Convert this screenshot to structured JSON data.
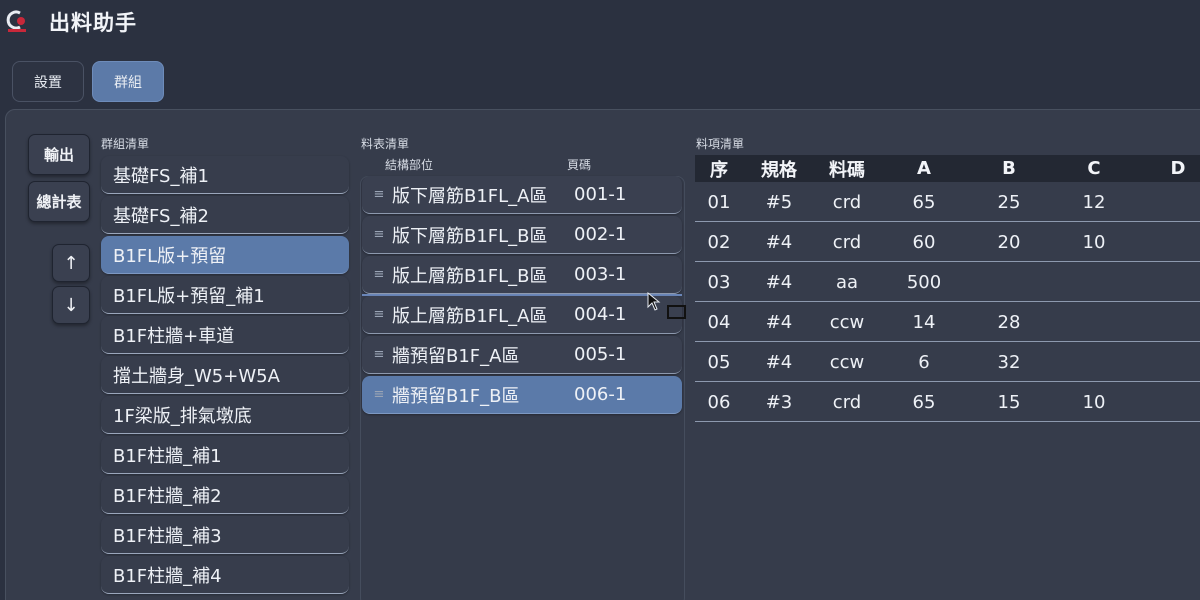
{
  "app": {
    "title": "出料助手",
    "logo_icon": "app-logo-icon"
  },
  "tabs": [
    {
      "label": "設置",
      "active": false
    },
    {
      "label": "群組",
      "active": true
    }
  ],
  "actions": {
    "export_label": "輸出",
    "summary_label": "總計表",
    "move_up": "↑",
    "move_down": "↓"
  },
  "group_panel": {
    "label": "群組清單",
    "items": [
      {
        "label": "基礎FS_補1"
      },
      {
        "label": "基礎FS_補2"
      },
      {
        "label": "B1FL版+預留",
        "selected": true
      },
      {
        "label": "B1FL版+預留_補1"
      },
      {
        "label": "B1F柱牆+車道"
      },
      {
        "label": "擋土牆身_W5+W5A"
      },
      {
        "label": "1F梁版_排氣墩底"
      },
      {
        "label": "B1F柱牆_補1"
      },
      {
        "label": "B1F柱牆_補2"
      },
      {
        "label": "B1F柱牆_補3"
      },
      {
        "label": "B1F柱牆_補4"
      }
    ]
  },
  "sheet_panel": {
    "label": "料表清單",
    "col_part": "結構部位",
    "col_page": "頁碼",
    "handle_icon": "≡",
    "items": [
      {
        "name": "版下層筋B1FL_A區",
        "page": "001-1"
      },
      {
        "name": "版下層筋B1FL_B區",
        "page": "002-1"
      },
      {
        "name": "版上層筋B1FL_B區",
        "page": "003-1"
      },
      {
        "name": "版上層筋B1FL_A區",
        "page": "004-1"
      },
      {
        "name": "牆預留B1F_A區",
        "page": "005-1"
      },
      {
        "name": "牆預留B1F_B區",
        "page": "006-1",
        "selected": true
      }
    ]
  },
  "item_panel": {
    "label": "料項清單",
    "columns": [
      "序",
      "規格",
      "料碼",
      "A",
      "B",
      "C",
      "D"
    ],
    "rows": [
      [
        "01",
        "#5",
        "crd",
        "65",
        "25",
        "12",
        ""
      ],
      [
        "02",
        "#4",
        "crd",
        "60",
        "20",
        "10",
        ""
      ],
      [
        "03",
        "#4",
        "aa",
        "500",
        "",
        "",
        ""
      ],
      [
        "04",
        "#4",
        "ccw",
        "14",
        "28",
        "",
        ""
      ],
      [
        "05",
        "#4",
        "ccw",
        "6",
        "32",
        "",
        ""
      ],
      [
        "06",
        "#3",
        "crd",
        "65",
        "15",
        "10",
        ""
      ]
    ]
  },
  "colors": {
    "background": "#2b3140",
    "accent": "#5b7aa9",
    "panel": "#363c4b",
    "header": "#232833"
  }
}
